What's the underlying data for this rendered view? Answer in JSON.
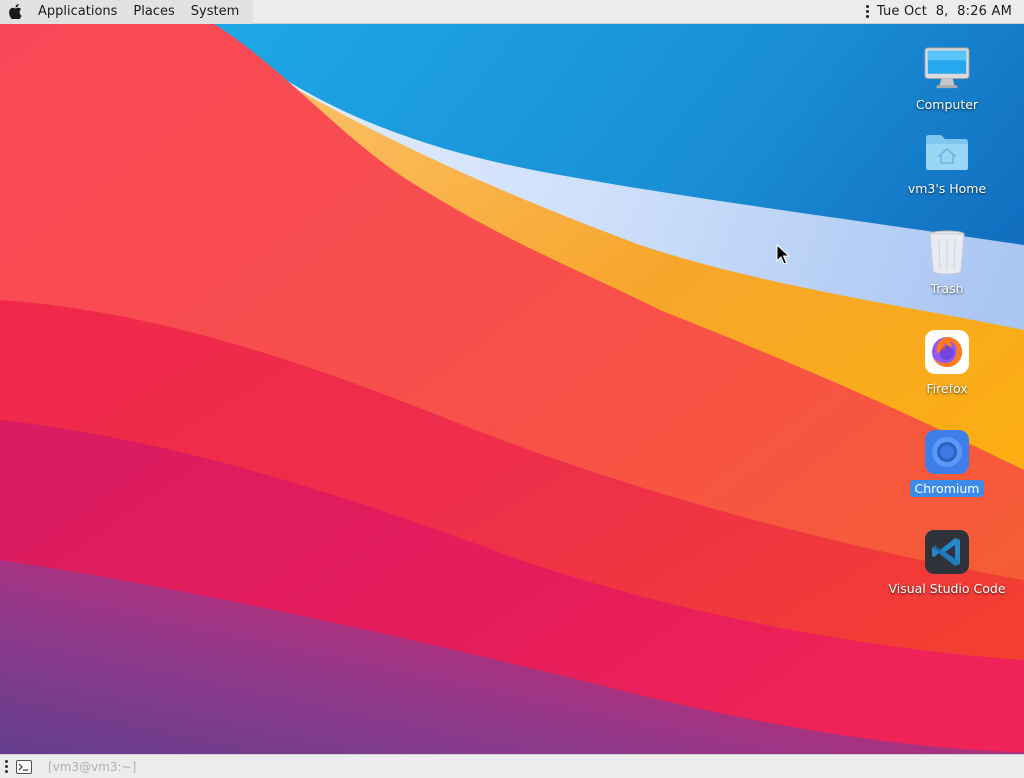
{
  "top_panel": {
    "menus": [
      {
        "label": "Applications"
      },
      {
        "label": "Places"
      },
      {
        "label": "System"
      }
    ],
    "clock": "Tue Oct  8,  8:26 AM"
  },
  "desktop": {
    "icons": [
      {
        "label": "Computer",
        "icon": "computer-icon"
      },
      {
        "label": "vm3's Home",
        "icon": "home-folder-icon"
      },
      {
        "label": "Trash",
        "icon": "trash-icon"
      },
      {
        "label": "Firefox",
        "icon": "firefox-icon"
      },
      {
        "label": "Chromium",
        "icon": "chromium-icon",
        "selected": true
      },
      {
        "label": "Visual Studio Code",
        "icon": "vscode-icon"
      }
    ]
  },
  "bottom_panel": {
    "task": "[vm3@vm3:~]"
  },
  "colors": {
    "panel": "#ececec",
    "selection": "#3d8be9",
    "wallpaper_red": "#e8304c",
    "wallpaper_blue": "#1e8fd8",
    "wallpaper_orange": "#f5a623"
  }
}
